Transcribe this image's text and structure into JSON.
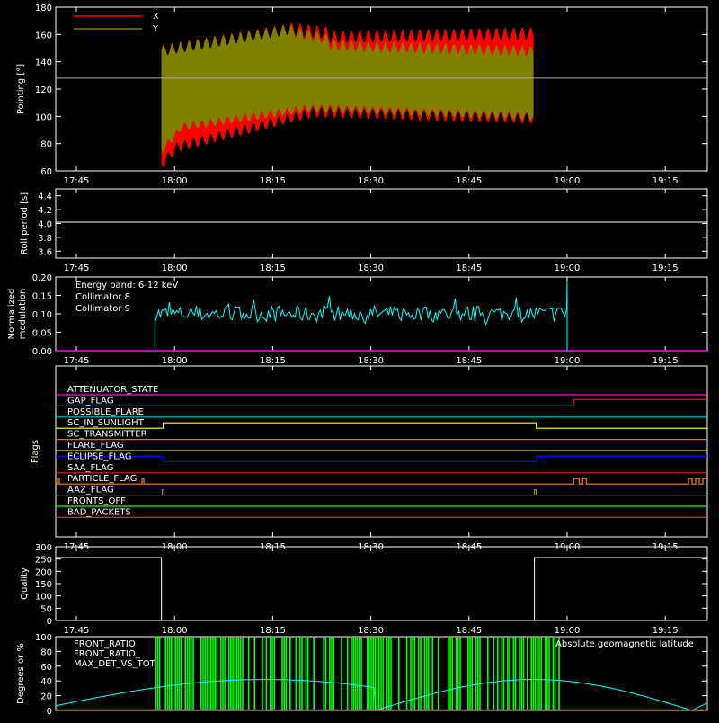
{
  "chart_data": [
    {
      "type": "area",
      "ylabel": "Pointing [°]",
      "ylim": [
        60,
        180
      ],
      "yticks": [
        60,
        80,
        100,
        120,
        140,
        160,
        180
      ],
      "xticks": [
        "17:45",
        "18:00",
        "18:15",
        "18:30",
        "18:45",
        "19:00",
        "19:15"
      ],
      "reference_line": 128,
      "legend": [
        {
          "name": "X",
          "color": "#ff0000"
        },
        {
          "name": "Y",
          "color": "#808000"
        }
      ],
      "series": [
        {
          "name": "X",
          "color": "#ff0000",
          "t_start": "17:58",
          "t_end": "18:55",
          "upper_start": 150,
          "upper_end": 160,
          "lower_min": 60,
          "lower_end": 98
        },
        {
          "name": "Y",
          "color": "#808000",
          "t_start": "17:58",
          "t_end": "18:55",
          "upper_start": 150,
          "upper_end": 148,
          "lower_min": 70,
          "lower_end": 98
        }
      ]
    },
    {
      "type": "line",
      "ylabel": "Roll period [s]",
      "ylim": [
        3.5,
        4.5
      ],
      "yticks": [
        "3.6",
        "3.8",
        "4.0",
        "4.2",
        "4.4"
      ],
      "xticks": [
        "17:45",
        "18:00",
        "18:15",
        "18:30",
        "18:45",
        "19:00",
        "19:15"
      ],
      "value": 4.02
    },
    {
      "type": "line",
      "ylabel": "Normalized modulation",
      "ylim": [
        0,
        0.2
      ],
      "yticks": [
        "0.00",
        "0.05",
        "0.10",
        "0.15",
        "0.20"
      ],
      "xticks": [
        "17:45",
        "18:00",
        "18:15",
        "18:30",
        "18:45",
        "19:00",
        "19:15"
      ],
      "annotation": "Energy band: 6-12 keV",
      "series": [
        {
          "name": "Collimator 8",
          "color": "#00ffff",
          "t_start": "17:57",
          "t_end": "19:00",
          "mean": 0.1
        },
        {
          "name": "Collimator 9",
          "color": "#ff00ff",
          "value": 0
        }
      ]
    },
    {
      "type": "line",
      "ylabel": "Flags",
      "xticks": [
        "17:45",
        "18:00",
        "18:15",
        "18:30",
        "18:45",
        "19:00",
        "19:15"
      ],
      "flags": [
        {
          "name": "ATTENUATOR_STATE",
          "color": "#ff00ff"
        },
        {
          "name": "GAP_FLAG",
          "color": "#ff0000"
        },
        {
          "name": "POSSIBLE_FLARE",
          "color": "#00c8c8"
        },
        {
          "name": "SC_IN_SUNLIGHT",
          "color": "#ffff00"
        },
        {
          "name": "SC_TRANSMITTER",
          "color": "#ff6600"
        },
        {
          "name": "FLARE_FLAG",
          "color": "#e0e040"
        },
        {
          "name": "ECLIPSE_FLAG",
          "color": "#0000ff"
        },
        {
          "name": "SAA_FLAG",
          "color": "#dd2222"
        },
        {
          "name": "PARTICLE_FLAG",
          "color": "#ff8800"
        },
        {
          "name": "AAZ_FLAG",
          "color": "#a08020"
        },
        {
          "name": "FRONTS_OFF",
          "color": "#00ff00"
        },
        {
          "name": "BAD_PACKETS",
          "color": "#ff2020"
        }
      ]
    },
    {
      "type": "line",
      "ylabel": "Quality",
      "ylim": [
        0,
        300
      ],
      "yticks": [
        "0",
        "50",
        "100",
        "150",
        "200",
        "250",
        "300"
      ],
      "xticks": [
        "17:45",
        "18:00",
        "18:15",
        "18:30",
        "18:45",
        "19:00",
        "19:15"
      ],
      "series": [
        {
          "name": "Quality",
          "color": "#ffffff",
          "values": [
            256,
            0,
            256
          ],
          "breaks": [
            "17:58",
            "18:55"
          ]
        }
      ]
    },
    {
      "type": "line",
      "ylabel": "Degrees or %",
      "ylim": [
        0,
        100
      ],
      "yticks": [
        "0",
        "20",
        "40",
        "60",
        "80",
        "100"
      ],
      "series": [
        {
          "name": "FRONT_RATIO",
          "color": "#ffff00"
        },
        {
          "name": "FRONT_RATIO_",
          "color": "#00ff00"
        },
        {
          "name": "MAX_DET_VS_TOT",
          "color": "#ff8800"
        },
        {
          "name": "Absolute geomagnetic latitude",
          "color": "#00ffff",
          "peak": 42
        }
      ]
    }
  ]
}
